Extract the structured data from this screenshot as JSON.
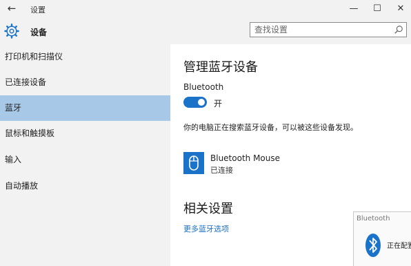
{
  "window": {
    "title": "设置",
    "back_icon": "←",
    "minimize_icon": "—",
    "maximize_icon": "☐",
    "close_icon": "✕"
  },
  "header": {
    "title": "设备",
    "search_placeholder": "查找设置"
  },
  "sidebar": {
    "items": [
      {
        "label": "打印机和扫描仪",
        "active": false
      },
      {
        "label": "已连接设备",
        "active": false
      },
      {
        "label": "蓝牙",
        "active": true
      },
      {
        "label": "鼠标和触摸板",
        "active": false
      },
      {
        "label": "输入",
        "active": false
      },
      {
        "label": "自动播放",
        "active": false
      }
    ]
  },
  "main": {
    "manage_title": "管理蓝牙设备",
    "bluetooth_label": "Bluetooth",
    "toggle_state": "开",
    "toggle_on": true,
    "description": "你的电脑正在搜索蓝牙设备，可以被这些设备发现。",
    "devices": [
      {
        "name": "Bluetooth Mouse",
        "status": "已连接",
        "icon": "mouse-icon"
      }
    ],
    "related_title": "相关设置",
    "related_link": "更多蓝牙选项"
  },
  "toast": {
    "title": "Bluetooth",
    "text": "正在配置",
    "icon": "bluetooth-icon"
  },
  "colors": {
    "accent": "#1a73c9",
    "active_nav": "#a8c8e8",
    "chrome": "#f2f2f2",
    "link": "#1a6fc4"
  }
}
